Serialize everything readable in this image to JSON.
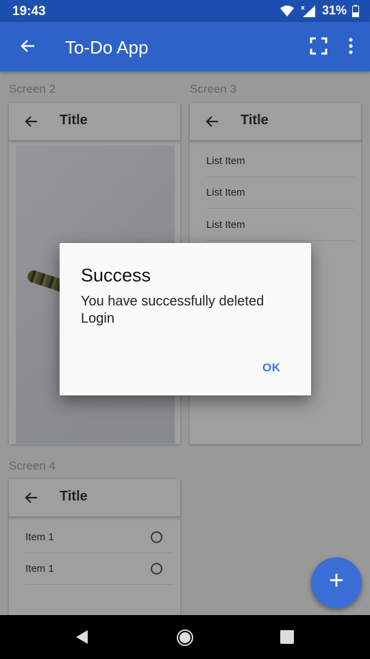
{
  "status_bar": {
    "time": "19:43",
    "battery": "31%"
  },
  "app_bar": {
    "title": "To-Do App"
  },
  "sections": {
    "screen2": "Screen 2",
    "screen3": "Screen 3",
    "screen4": "Screen 4"
  },
  "screen2_card": {
    "title": "Title"
  },
  "screen3_card": {
    "title": "Title",
    "items": [
      "List Item",
      "List Item",
      "List Item"
    ]
  },
  "screen4_card": {
    "title": "Title",
    "items": [
      "Item 1",
      "Item 1"
    ]
  },
  "fab": {
    "label": "+"
  },
  "dialog": {
    "title": "Success",
    "message": "You have successfully deleted Login",
    "ok_label": "OK"
  },
  "colors": {
    "app_bar": "#2d62c9",
    "status_bar": "#1d4fb0",
    "accent": "#3b78e7"
  }
}
